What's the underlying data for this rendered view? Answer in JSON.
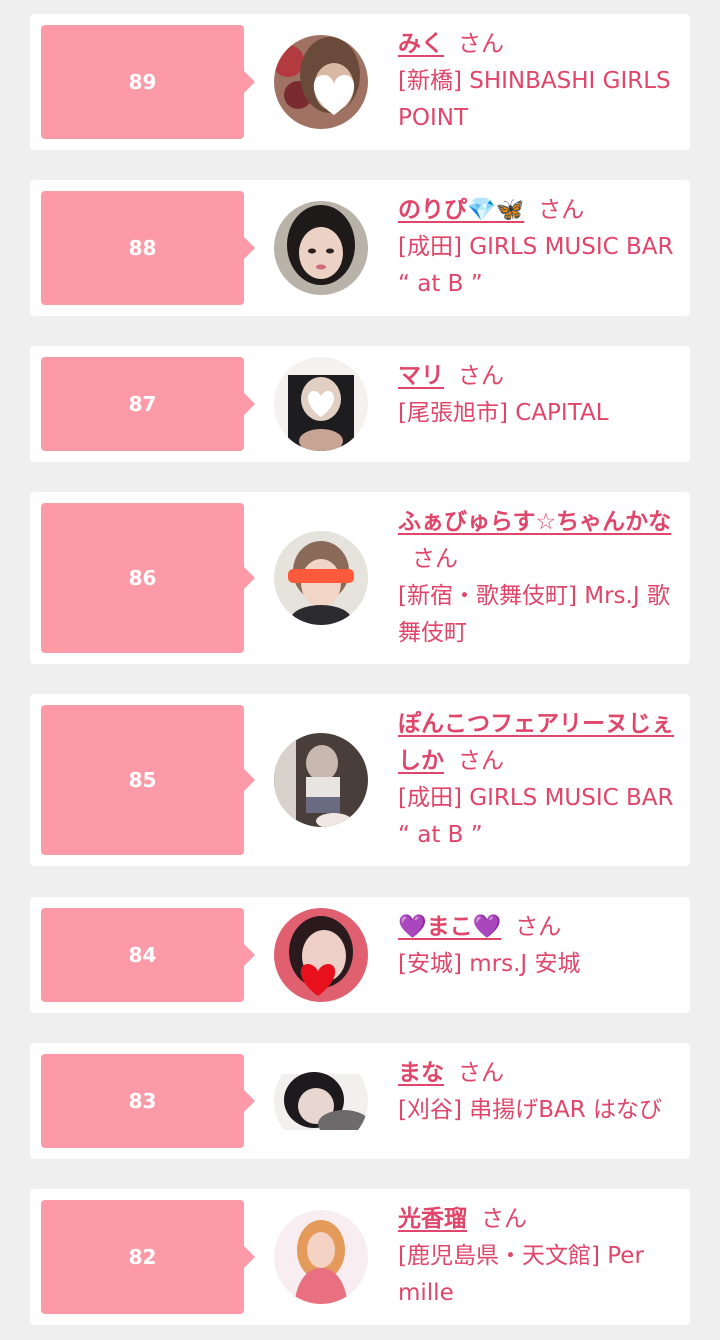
{
  "honorific": "さん",
  "entries": [
    {
      "rank": "89",
      "name": "みく",
      "shop": "[新橋] SHINBASHI GIRLS POINT",
      "avatar": "photo-heart-sticker"
    },
    {
      "rank": "88",
      "name": "のりぴ💎🦋",
      "shop": "[成田] GIRLS MUSIC BAR “ at B ”",
      "avatar": "photo"
    },
    {
      "rank": "87",
      "name": "マリ",
      "shop": "[尾張旭市] CAPITAL",
      "avatar": "photo-heart-sticker"
    },
    {
      "rank": "86",
      "name": "ふぁびゅらす☆ちゃんかな",
      "shop": "[新宿・歌舞伎町] Mrs.J 歌舞伎町",
      "avatar": "photo-glasses-sticker"
    },
    {
      "rank": "85",
      "name": "ぽんこつフェアリーヌじぇしか",
      "shop": "[成田] GIRLS MUSIC BAR “ at B ”",
      "avatar": "photo"
    },
    {
      "rank": "84",
      "name": "💜まこ💜",
      "shop": "[安城] mrs.J 安城",
      "avatar": "photo-red-heart-sticker"
    },
    {
      "rank": "83",
      "name": "まな",
      "shop": "[刈谷] 串揚げBAR はなび",
      "avatar": "photo"
    },
    {
      "rank": "82",
      "name": "光香瑠",
      "shop": "[鹿児島県・天文館] Per mille",
      "avatar": "photo"
    }
  ],
  "colors": {
    "background": "#efefef",
    "card": "#ffffff",
    "rank_badge": "#fc9aa8",
    "text_accent": "#e0456a"
  }
}
